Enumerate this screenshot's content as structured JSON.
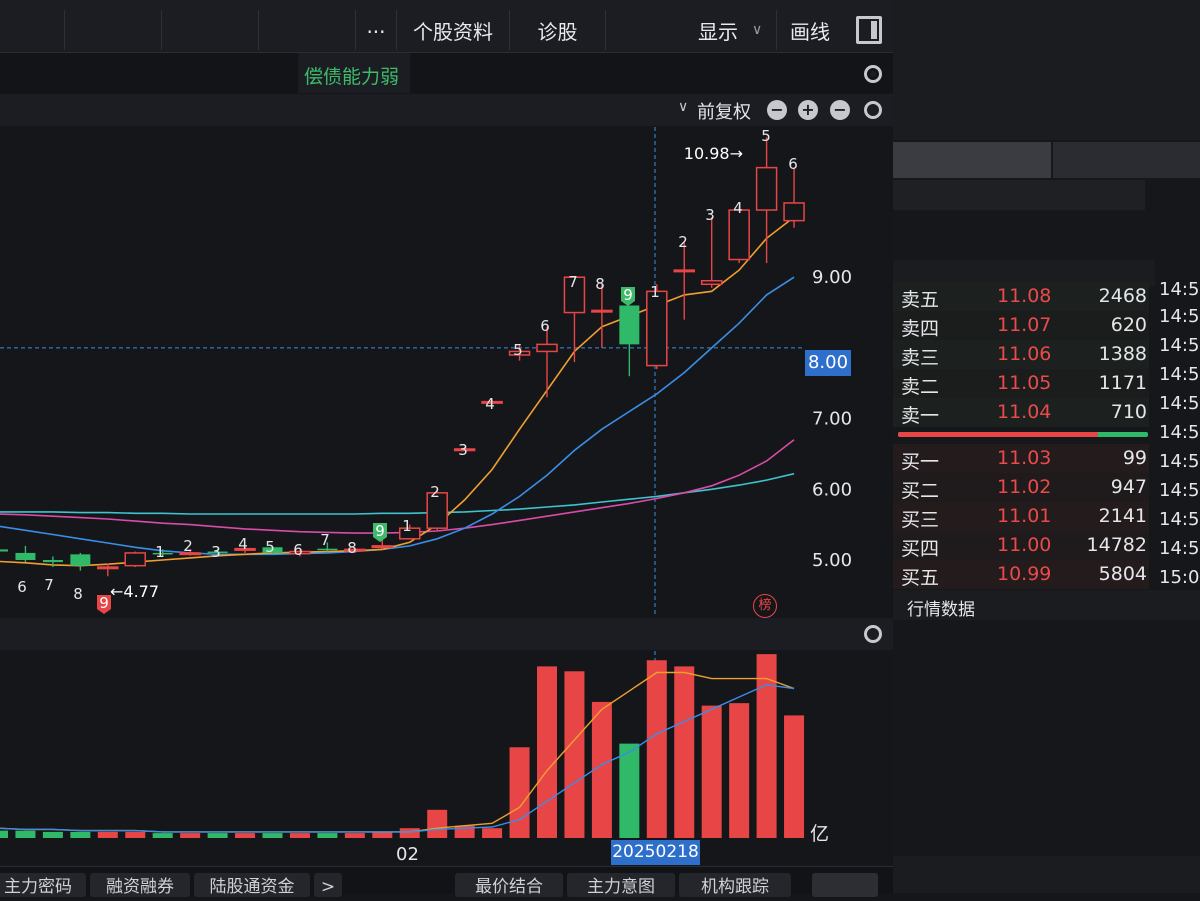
{
  "toolbar": {
    "more_label": "···",
    "stock_info_label": "个股资料",
    "diagnose_label": "诊股",
    "display_label": "显示",
    "draw_label": "画线"
  },
  "info_bar": {
    "warning_text": "偿债能力弱"
  },
  "sub_bar": {
    "adjust_label": "前复权"
  },
  "main_chart": {
    "y_ticks": [
      "9.00",
      "8.00",
      "7.00",
      "6.00",
      "5.00"
    ],
    "crosshair_price": "8.00",
    "high_annotation": "10.98→",
    "low_annotation": "←4.77",
    "badge_text": "榜",
    "td_labels": [
      "6",
      "7",
      "8",
      "9",
      "1",
      "2",
      "3",
      "4",
      "5",
      "6",
      "7",
      "8",
      "9",
      "1",
      "2",
      "3",
      "4",
      "5",
      "6",
      "7",
      "8",
      "9",
      "1",
      "2",
      "3",
      "4",
      "5",
      "6"
    ]
  },
  "vol_chart": {
    "unit_label": "亿",
    "x_label": "02",
    "crosshair_date": "20250218"
  },
  "bottom_tabs": [
    "主力密码",
    "融资融券",
    "陆股通资金",
    "最价结合",
    "主力意图",
    "机构跟踪"
  ],
  "order_book": {
    "asks": [
      {
        "name": "卖五",
        "price": "11.08",
        "vol": "2468",
        "time": "14:5"
      },
      {
        "name": "卖四",
        "price": "11.07",
        "vol": "620",
        "time": "14:5"
      },
      {
        "name": "卖三",
        "price": "11.06",
        "vol": "1388",
        "time": "14:5"
      },
      {
        "name": "卖二",
        "price": "11.05",
        "vol": "1171",
        "time": "14:5"
      },
      {
        "name": "卖一",
        "price": "11.04",
        "vol": "710",
        "time": "14:5"
      }
    ],
    "bids": [
      {
        "name": "买一",
        "price": "11.03",
        "vol": "99",
        "time": "14:5"
      },
      {
        "name": "买二",
        "price": "11.02",
        "vol": "947",
        "time": "14:5"
      },
      {
        "name": "买三",
        "price": "11.01",
        "vol": "2141",
        "time": "14:5"
      },
      {
        "name": "买四",
        "price": "11.00",
        "vol": "14782",
        "time": "14:5"
      },
      {
        "name": "买五",
        "price": "10.99",
        "vol": "5804",
        "time": "15:0"
      }
    ],
    "top_time": "14:5",
    "market_data_label": "行情数据",
    "buy_ratio": 0.8
  },
  "colors": {
    "up": "#e84646",
    "down": "#2fb968",
    "ma5": "#f0a030",
    "ma10": "#3a8ee6",
    "ma20": "#d84ca8",
    "ma60": "#3ec3cf",
    "accent_green": "#3dbb6a"
  },
  "chart_data": {
    "type": "candlestick",
    "candles": [
      {
        "o": 5.15,
        "h": 5.3,
        "l": 5.05,
        "c": 5.12
      },
      {
        "o": 5.1,
        "h": 5.2,
        "l": 4.97,
        "c": 5.0
      },
      {
        "o": 5.0,
        "h": 5.05,
        "l": 4.9,
        "c": 4.97
      },
      {
        "o": 5.08,
        "h": 5.1,
        "l": 4.85,
        "c": 4.92
      },
      {
        "o": 4.88,
        "h": 4.95,
        "l": 4.77,
        "c": 4.9
      },
      {
        "o": 4.92,
        "h": 5.12,
        "l": 4.9,
        "c": 5.1
      },
      {
        "o": 5.1,
        "h": 5.15,
        "l": 5.05,
        "c": 5.08
      },
      {
        "o": 5.1,
        "h": 5.15,
        "l": 5.06,
        "c": 5.1
      },
      {
        "o": 5.12,
        "h": 5.16,
        "l": 5.08,
        "c": 5.1
      },
      {
        "o": 5.14,
        "h": 5.18,
        "l": 5.1,
        "c": 5.16
      },
      {
        "o": 5.18,
        "h": 5.2,
        "l": 5.08,
        "c": 5.1
      },
      {
        "o": 5.09,
        "h": 5.14,
        "l": 5.05,
        "c": 5.12
      },
      {
        "o": 5.16,
        "h": 5.25,
        "l": 5.12,
        "c": 5.14
      },
      {
        "o": 5.13,
        "h": 5.18,
        "l": 5.1,
        "c": 5.15
      },
      {
        "o": 5.18,
        "h": 5.3,
        "l": 5.15,
        "c": 5.2
      },
      {
        "o": 5.3,
        "h": 5.5,
        "l": 5.3,
        "c": 5.45
      },
      {
        "o": 5.45,
        "h": 6.0,
        "l": 5.42,
        "c": 5.95
      },
      {
        "o": 6.57,
        "h": 6.6,
        "l": 6.55,
        "c": 6.57
      },
      {
        "o": 7.24,
        "h": 7.26,
        "l": 7.22,
        "c": 7.24
      },
      {
        "o": 7.9,
        "h": 8.05,
        "l": 7.82,
        "c": 7.95
      },
      {
        "o": 7.95,
        "h": 8.3,
        "l": 7.3,
        "c": 8.05
      },
      {
        "o": 8.5,
        "h": 9.0,
        "l": 7.8,
        "c": 9.0
      },
      {
        "o": 8.53,
        "h": 8.9,
        "l": 8.0,
        "c": 8.53
      },
      {
        "o": 8.6,
        "h": 8.6,
        "l": 7.6,
        "c": 8.05
      },
      {
        "o": 7.75,
        "h": 8.9,
        "l": 7.7,
        "c": 8.8
      },
      {
        "o": 9.1,
        "h": 9.5,
        "l": 8.4,
        "c": 9.1
      },
      {
        "o": 8.9,
        "h": 9.85,
        "l": 8.85,
        "c": 8.95
      },
      {
        "o": 9.25,
        "h": 10.0,
        "l": 9.2,
        "c": 9.95
      },
      {
        "o": 9.95,
        "h": 10.98,
        "l": 9.2,
        "c": 10.55
      },
      {
        "o": 9.8,
        "h": 10.55,
        "l": 9.7,
        "c": 10.05
      }
    ],
    "ma": [
      {
        "name": "MA5",
        "values": [
          4.98,
          4.96,
          4.93,
          4.92,
          4.94,
          4.97,
          5.0,
          5.03,
          5.06,
          5.08,
          5.1,
          5.11,
          5.12,
          5.13,
          5.15,
          5.25,
          5.5,
          5.85,
          6.28,
          6.85,
          7.4,
          7.95,
          8.3,
          8.45,
          8.6,
          8.75,
          8.8,
          9.1,
          9.55,
          9.85
        ]
      },
      {
        "name": "MA10",
        "values": [
          5.48,
          5.42,
          5.36,
          5.3,
          5.24,
          5.18,
          5.13,
          5.1,
          5.08,
          5.08,
          5.08,
          5.09,
          5.1,
          5.12,
          5.15,
          5.2,
          5.3,
          5.45,
          5.65,
          5.9,
          6.2,
          6.55,
          6.85,
          7.1,
          7.35,
          7.65,
          8.0,
          8.35,
          8.75,
          9.0
        ]
      },
      {
        "name": "MA20",
        "values": [
          5.65,
          5.64,
          5.62,
          5.6,
          5.58,
          5.55,
          5.52,
          5.5,
          5.47,
          5.44,
          5.42,
          5.4,
          5.39,
          5.38,
          5.38,
          5.39,
          5.41,
          5.45,
          5.5,
          5.56,
          5.62,
          5.68,
          5.74,
          5.8,
          5.87,
          5.95,
          6.05,
          6.2,
          6.4,
          6.7
        ]
      },
      {
        "name": "MA60",
        "values": [
          5.68,
          5.68,
          5.68,
          5.67,
          5.67,
          5.66,
          5.66,
          5.65,
          5.65,
          5.65,
          5.65,
          5.65,
          5.65,
          5.65,
          5.66,
          5.66,
          5.67,
          5.68,
          5.7,
          5.72,
          5.75,
          5.78,
          5.82,
          5.86,
          5.9,
          5.95,
          6.0,
          6.06,
          6.13,
          6.22
        ]
      }
    ],
    "volume": [
      0.06,
      0.06,
      0.05,
      0.05,
      0.05,
      0.05,
      0.04,
      0.04,
      0.04,
      0.04,
      0.04,
      0.04,
      0.04,
      0.04,
      0.05,
      0.08,
      0.23,
      0.1,
      0.08,
      0.74,
      1.4,
      1.36,
      1.11,
      0.77,
      1.45,
      1.4,
      1.08,
      1.1,
      1.5,
      1.0
    ],
    "vol_ma": [
      {
        "name": "VMA5",
        "values": [
          0.08,
          0.07,
          0.07,
          0.06,
          0.06,
          0.06,
          0.05,
          0.05,
          0.05,
          0.05,
          0.05,
          0.05,
          0.05,
          0.05,
          0.05,
          0.05,
          0.08,
          0.1,
          0.12,
          0.25,
          0.55,
          0.8,
          1.05,
          1.2,
          1.35,
          1.35,
          1.3,
          1.3,
          1.3,
          1.22
        ]
      },
      {
        "name": "VMA10",
        "values": [
          0.08,
          0.07,
          0.07,
          0.06,
          0.06,
          0.06,
          0.05,
          0.05,
          0.05,
          0.05,
          0.05,
          0.05,
          0.05,
          0.05,
          0.05,
          0.05,
          0.07,
          0.08,
          0.09,
          0.15,
          0.3,
          0.45,
          0.6,
          0.7,
          0.85,
          0.95,
          1.05,
          1.15,
          1.25,
          1.22
        ]
      }
    ],
    "ylim": [
      4.5,
      11.3
    ],
    "vol_max": 1.55
  }
}
